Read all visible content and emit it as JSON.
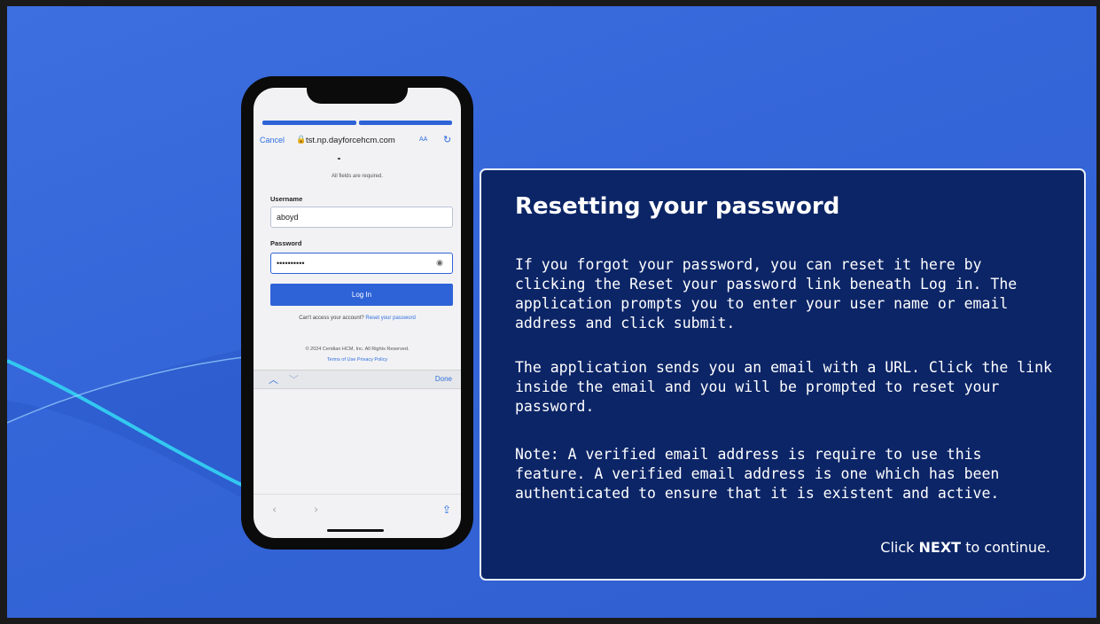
{
  "phone": {
    "cancel": "Cancel",
    "url": "tst.np.dayforcehcm.com",
    "aa": "AA",
    "required_note": "All fields are required.",
    "username_label": "Username",
    "username_value": "aboyd",
    "password_label": "Password",
    "password_value": "••••••••••",
    "login_button": "Log In",
    "access_text": "Can't access your account?",
    "reset_link": "Reset your password",
    "copyright": "© 2024 Ceridian HCM, Inc. All Rights Reserved.",
    "terms": "Terms of Use",
    "privacy": "Privacy Policy",
    "done": "Done"
  },
  "panel": {
    "title": "Resetting your password",
    "para1": "If you forgot your password, you can reset it here by clicking the Reset your password link beneath Log in. The application prompts you to enter your user name or email address and click submit.",
    "para2": "The application sends you an email with a URL. Click the link inside the email and you will be prompted to reset your password.",
    "para3": "Note: A verified email address is require to use this feature. A verified email address is one which has been authenticated to ensure that it is existent and active.",
    "cta_prefix": "Click",
    "cta_bold": "NEXT",
    "cta_suffix": "to continue."
  },
  "colors": {
    "background": "#3566d9",
    "panel": "#0c2567",
    "accent": "#2e63d8"
  }
}
